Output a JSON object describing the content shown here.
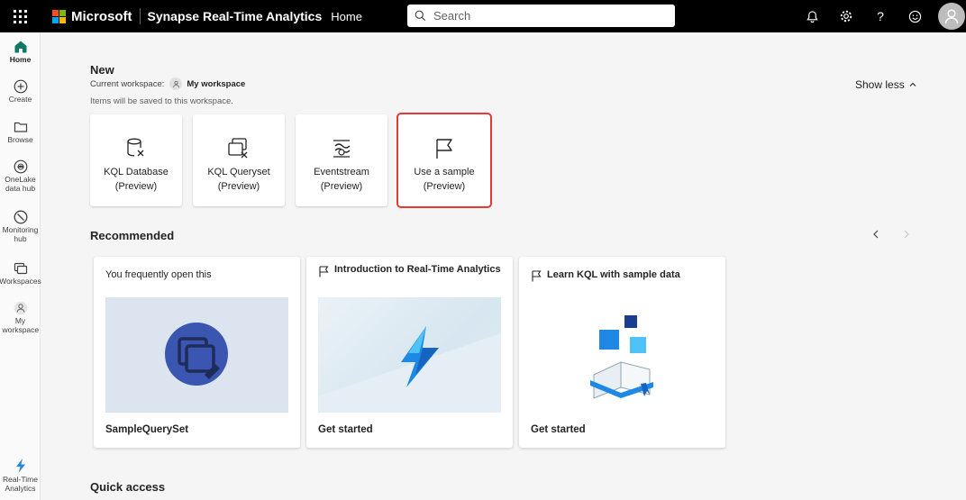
{
  "topbar": {
    "brand": "Microsoft",
    "app_name": "Synapse Real-Time Analytics",
    "breadcrumb": "Home",
    "search_placeholder": "Search",
    "icons": [
      "notifications-icon",
      "settings-icon",
      "help-icon",
      "feedback-icon",
      "account-avatar"
    ]
  },
  "rail": {
    "items": [
      {
        "label": "Home",
        "icon": "home-icon",
        "active": true
      },
      {
        "label": "Create",
        "icon": "create-plus-icon"
      },
      {
        "label": "Browse",
        "icon": "folder-icon"
      },
      {
        "label": "OneLake data hub",
        "icon": "onelake-icon"
      },
      {
        "label": "Monitoring hub",
        "icon": "monitoring-icon"
      },
      {
        "label": "Workspaces",
        "icon": "workspaces-icon"
      },
      {
        "label": "My workspace",
        "icon": "my-workspace-icon"
      }
    ],
    "bottom": {
      "label": "Real-Time Analytics",
      "icon": "real-time-analytics-icon"
    }
  },
  "new_section": {
    "title": "New",
    "workspace_label": "Current workspace:",
    "workspace_name": "My workspace",
    "saved_note": "Items will be saved to this workspace.",
    "show_less": "Show less",
    "cards": [
      {
        "line1": "KQL Database",
        "line2": "(Preview)",
        "icon": "kql-database-icon"
      },
      {
        "line1": "KQL Queryset",
        "line2": "(Preview)",
        "icon": "kql-queryset-icon"
      },
      {
        "line1": "Eventstream",
        "line2": "(Preview)",
        "icon": "eventstream-icon"
      },
      {
        "line1": "Use a sample",
        "line2": "(Preview)",
        "icon": "flag-icon",
        "highlighted": true
      }
    ]
  },
  "recommended": {
    "title": "Recommended",
    "cards": [
      {
        "header": "You frequently open this",
        "footer": "SampleQuerySet"
      },
      {
        "header": "Introduction to Real-Time Analytics",
        "footer": "Get started"
      },
      {
        "header": "Learn KQL with sample data",
        "footer": "Get started"
      }
    ]
  },
  "quick_access": {
    "title": "Quick access"
  },
  "colors": {
    "topbar": "#000000",
    "accent_green": "#117865",
    "highlight_border": "#e53935",
    "page_bg": "#f5f5f5"
  }
}
